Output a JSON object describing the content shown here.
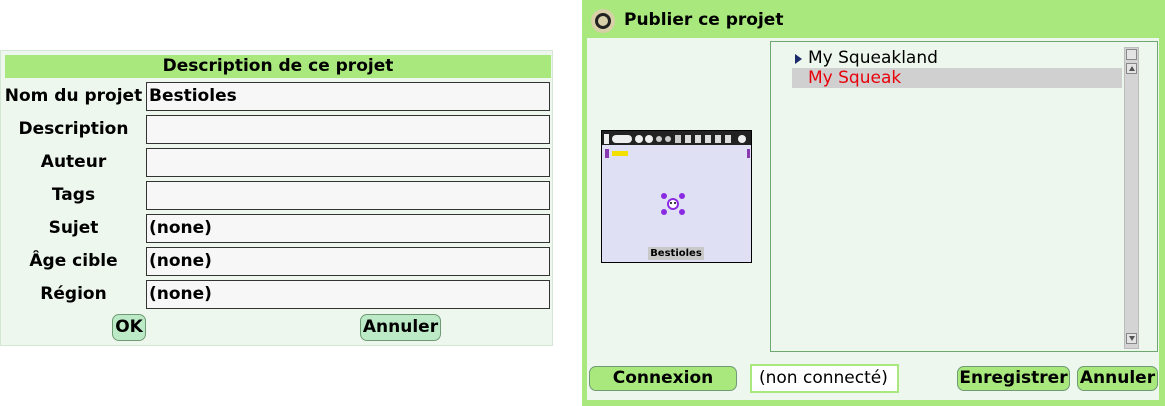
{
  "description_dialog": {
    "title": "Description de ce projet",
    "fields": [
      {
        "label": "Nom du projet",
        "value": "Bestioles"
      },
      {
        "label": "Description",
        "value": ""
      },
      {
        "label": "Auteur",
        "value": ""
      },
      {
        "label": "Tags",
        "value": ""
      },
      {
        "label": "Sujet",
        "value": "(none)"
      },
      {
        "label": "Âge cible",
        "value": "(none)"
      },
      {
        "label": "Région",
        "value": "(none)"
      }
    ],
    "ok_label": "OK",
    "cancel_label": "Annuler"
  },
  "publish_dialog": {
    "title": "Publier ce projet",
    "thumbnail_label": "Bestioles",
    "tree": {
      "items": [
        {
          "label": "My Squeakland",
          "expandable": true,
          "selected": false
        },
        {
          "label": "My Squeak",
          "expandable": false,
          "selected": true
        }
      ]
    },
    "connect_label": "Connexion",
    "status_text": "(non connecté)",
    "save_label": "Enregistrer",
    "cancel_label": "Annuler"
  },
  "colors": {
    "accent_green": "#a8e87c",
    "panel_bg": "#eef7ee",
    "selected_text": "#e8000a"
  }
}
